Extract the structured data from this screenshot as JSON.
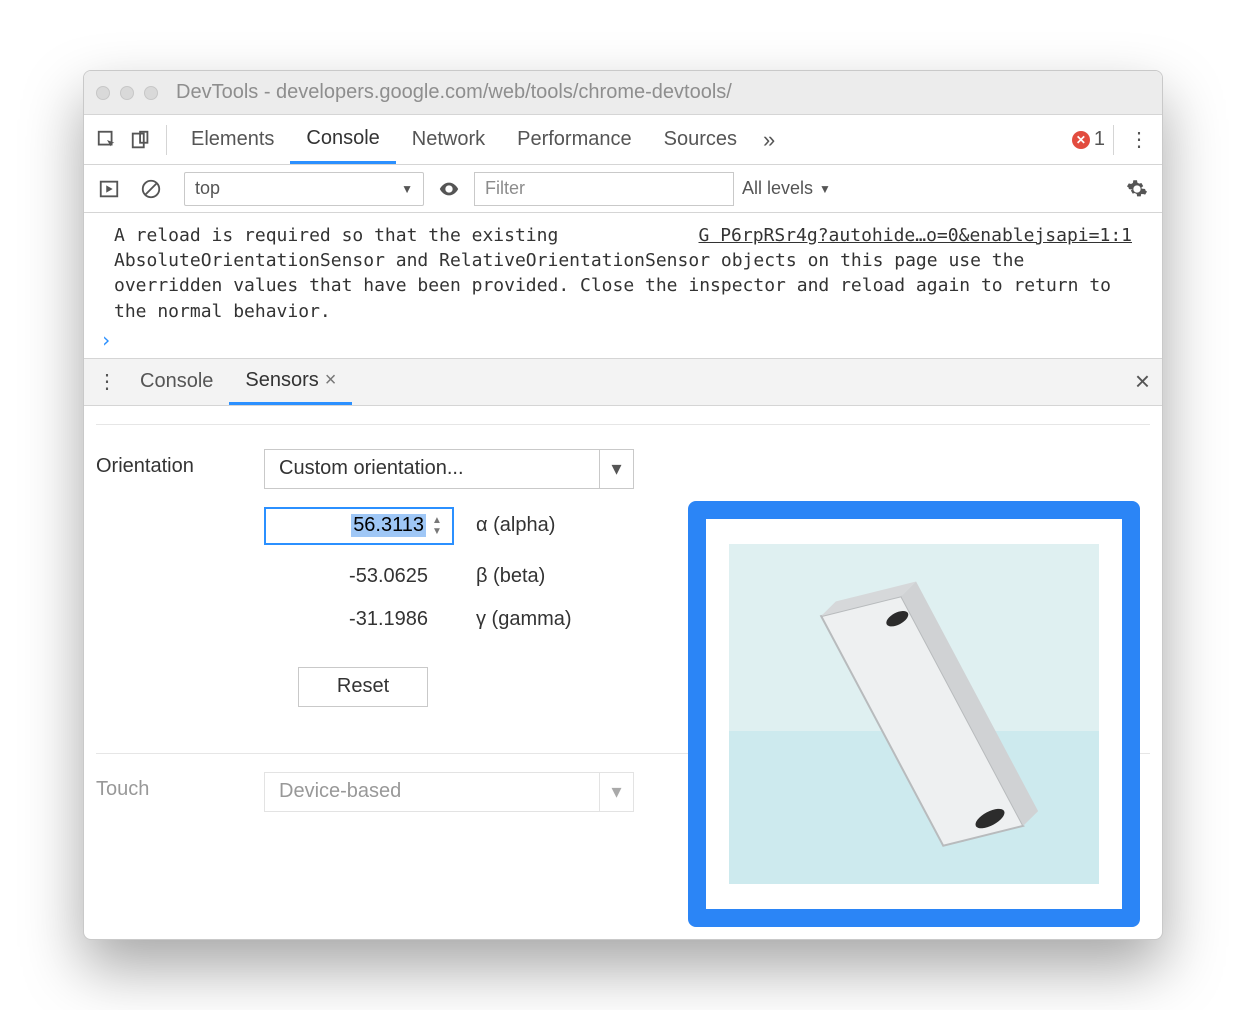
{
  "window": {
    "title": "DevTools - developers.google.com/web/tools/chrome-devtools/"
  },
  "tabs": {
    "items": [
      "Elements",
      "Console",
      "Network",
      "Performance",
      "Sources"
    ],
    "active": "Console",
    "more_glyph": "»",
    "error_count": "1"
  },
  "console_toolbar": {
    "context": "top",
    "filter_placeholder": "Filter",
    "levels_label": "All levels"
  },
  "console": {
    "source_link": "G P6rpRSr4g?autohide…o=0&enablejsapi=1:1",
    "message": "A reload is required so that the existing AbsoluteOrientationSensor and RelativeOrientationSensor objects on this page use the overridden values that have been provided. Close the inspector and reload again to return to the normal behavior.",
    "prompt_glyph": "›"
  },
  "drawer": {
    "tabs": [
      "Console",
      "Sensors"
    ],
    "active": "Sensors",
    "close_glyph": "×"
  },
  "sensors": {
    "orientation_label": "Orientation",
    "orientation_select": "Custom orientation...",
    "alpha": {
      "value": "56.3113",
      "label": "α (alpha)"
    },
    "beta": {
      "value": "-53.0625",
      "label": "β (beta)"
    },
    "gamma": {
      "value": "-31.1986",
      "label": "γ (gamma)"
    },
    "reset_label": "Reset",
    "touch_label": "Touch",
    "touch_select": "Device-based"
  }
}
